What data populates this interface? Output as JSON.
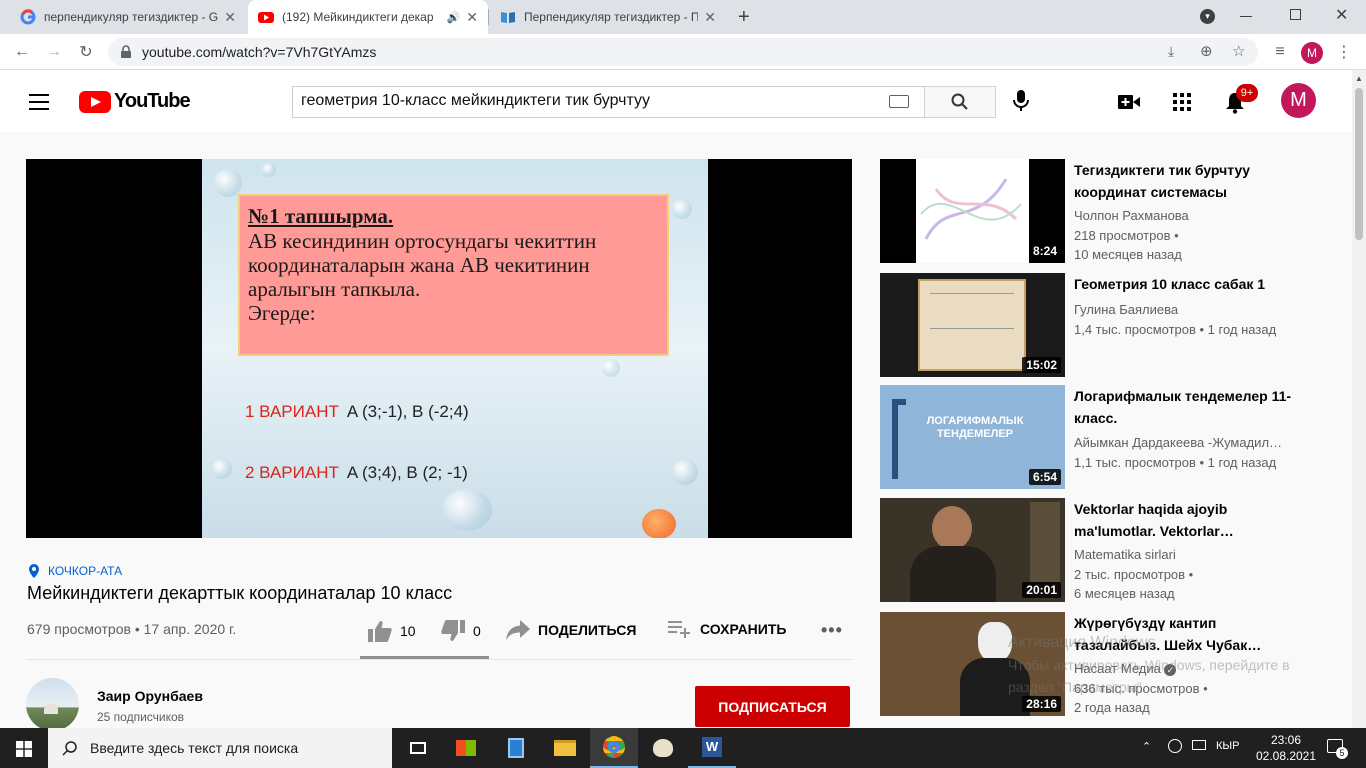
{
  "browser": {
    "tabs": [
      {
        "title": "перпендикуляр тегиздиктер - Go",
        "active": false
      },
      {
        "title": "(192) Мейкиндиктеги декар",
        "active": true
      },
      {
        "title": "Перпендикуляр тегиздиктер - Пр",
        "active": false
      }
    ],
    "url": "youtube.com/watch?v=7Vh7GtYAmzs",
    "profile_initial": "M"
  },
  "header": {
    "logo_text": "YouTube",
    "search_query": "геометрия 10-класс мейкиндиктеги тик бурчтуу",
    "notifications_badge": "9+",
    "avatar_initial": "M"
  },
  "slide": {
    "heading": "№1 тапшырма.",
    "lines": [
      "АВ кесиндинин ортосундагы чекиттин",
      "координаталарын жана АВ чекитинин",
      "аралыгын тапкыла.",
      "Эгерде:"
    ],
    "variant1_label": "1 ВАРИАНТ",
    "variant1_value": "A (3;-1), B (-2;4)",
    "variant2_label": "2 ВАРИАНТ",
    "variant2_value": "A (3;4), B (2; -1)"
  },
  "video": {
    "location": "КОЧКОР-АТА",
    "title": "Мейкиндиктеги декарттык координаталар 10 класс",
    "views_date": "679 просмотров • 17 апр. 2020 г.",
    "likes": "10",
    "dislikes": "0",
    "share_label": "ПОДЕЛИТЬСЯ",
    "save_label": "СОХРАНИТЬ"
  },
  "channel": {
    "name": "Заир Орунбаев",
    "subscribers": "25 подписчиков",
    "subscribe_label": "ПОДПИСАТЬСЯ"
  },
  "related": [
    {
      "title": "Тегиздиктеги тик бурчтуу координат системасы",
      "channel": "Чолпон Рахманова",
      "views": "218 просмотров •",
      "age": "10 месяцев назад",
      "duration": "8:24"
    },
    {
      "title": "Геометрия 10 класс сабак 1",
      "channel": "Гулина Баялиева",
      "views": "1,4 тыс. просмотров • 1 год назад",
      "age": "",
      "duration": "15:02"
    },
    {
      "title": "Логарифмалык тендемелер 11-класс.",
      "channel": "Айымкан Дардакеева -Жумадил…",
      "views": "1,1 тыс. просмотров • 1 год назад",
      "age": "",
      "duration": "6:54"
    },
    {
      "title": "Vektorlar haqida ajoyib ma'lumotlar. Vektorlar…",
      "channel": "Matematika sirlari",
      "views": "2 тыс. просмотров •",
      "age": "6 месяцев назад",
      "duration": "20:01"
    },
    {
      "title": "Жүрөгүбүздү кантип тазалайбыз. Шейх Чубак…",
      "channel": "Насаат Медиа",
      "views": "636 тыс. просмотров •",
      "age": "2 года назад",
      "duration": "28:16"
    }
  ],
  "thumb_texts": {
    "log_title": "ЛОГАРИФМАЛЫК ТЕНДЕМЕЛЕР"
  },
  "watermark": {
    "line1": "Активация Windows",
    "line2": "Чтобы активировать Windows, перейдите в",
    "line3": "раздел \"Параметры\"."
  },
  "taskbar": {
    "search_placeholder": "Введите здесь текст для поиска",
    "language": "КЫР",
    "time": "23:06",
    "date": "02.08.2021",
    "notifications": "5"
  },
  "colors": {
    "youtube_red": "#ff0000",
    "subscribe_red": "#cc0000",
    "link_blue": "#065fd4"
  }
}
